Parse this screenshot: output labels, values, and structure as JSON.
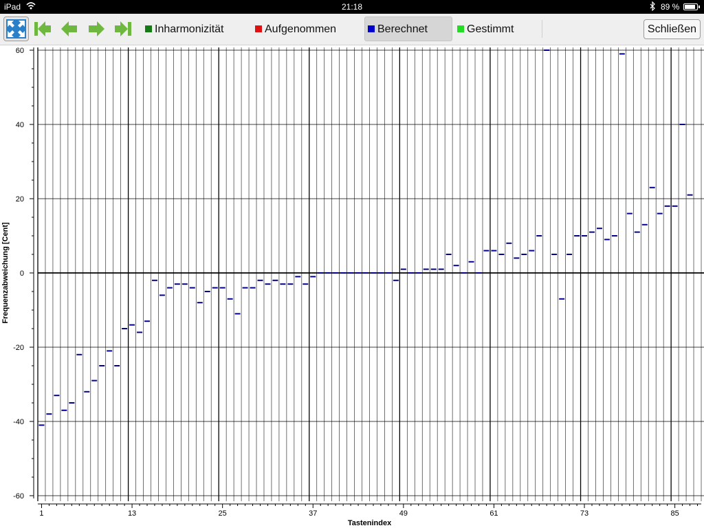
{
  "status_bar": {
    "device": "iPad",
    "time": "21:18",
    "battery": "89 %",
    "battery_level": 0.89
  },
  "toolbar": {
    "legend": [
      {
        "label": "Inharmonizität",
        "color": "#147a14"
      },
      {
        "label": "Aufgenommen",
        "color": "#e01010"
      },
      {
        "label": "Berechnet",
        "color": "#0000cc",
        "selected": true
      },
      {
        "label": "Gestimmt",
        "color": "#22dd22"
      }
    ],
    "close_label": "Schließen",
    "nav_icon_color": "#6fb83f"
  },
  "chart_data": {
    "type": "step",
    "xlabel": "Tastenindex",
    "ylabel": "Frequenzabweichung [Cent]",
    "xlim": [
      0.5,
      88.5
    ],
    "ylim": [
      -60,
      60
    ],
    "x_ticks": [
      1,
      13,
      25,
      37,
      49,
      61,
      73,
      85
    ],
    "y_ticks": [
      -60,
      -40,
      -20,
      0,
      20,
      40,
      60
    ],
    "y_tick_labels": [
      "-60",
      "-40",
      "-20",
      "0",
      "20",
      "40",
      "60"
    ],
    "series": [
      {
        "color": "#00008b",
        "x": [
          1,
          2,
          3,
          4,
          5,
          6,
          7,
          8,
          9,
          10,
          11,
          12,
          13,
          14,
          15,
          16,
          17,
          18,
          19,
          20,
          21,
          22,
          23,
          24,
          25,
          26,
          27,
          28,
          29,
          30,
          31,
          32,
          33,
          34,
          35,
          36,
          37,
          38,
          39,
          40,
          41,
          42,
          43,
          44,
          45,
          46,
          47,
          48,
          49,
          50,
          51,
          52,
          53,
          54,
          55,
          56,
          57,
          58,
          59,
          60,
          61,
          62,
          63,
          64,
          65,
          66,
          67,
          68,
          69,
          70,
          71,
          72,
          73,
          74,
          75,
          76,
          77,
          78,
          79,
          80,
          81,
          82,
          83,
          84,
          85,
          86,
          87,
          88
        ],
        "values": [
          -41,
          -38,
          -33,
          -37,
          -35,
          -22,
          -32,
          -29,
          -25,
          -21,
          -25,
          -15,
          -14,
          -16,
          -13,
          -2,
          -6,
          -4,
          -3,
          -3,
          -4,
          -8,
          -5,
          -4,
          -4,
          -7,
          -11,
          -4,
          -4,
          -2,
          -3,
          -2,
          -3,
          -3,
          -1,
          -3,
          -1,
          0,
          0,
          0,
          0,
          0,
          0,
          0,
          0,
          0,
          0,
          -2,
          1,
          0,
          0,
          1,
          1,
          1,
          5,
          2,
          0,
          3,
          0,
          6,
          6,
          5,
          8,
          4,
          5,
          6,
          10,
          60,
          5,
          -7,
          5,
          10,
          10,
          11,
          12,
          9,
          10,
          59,
          16,
          11,
          13,
          23,
          16,
          18,
          18,
          40,
          21,
          null
        ]
      }
    ]
  }
}
